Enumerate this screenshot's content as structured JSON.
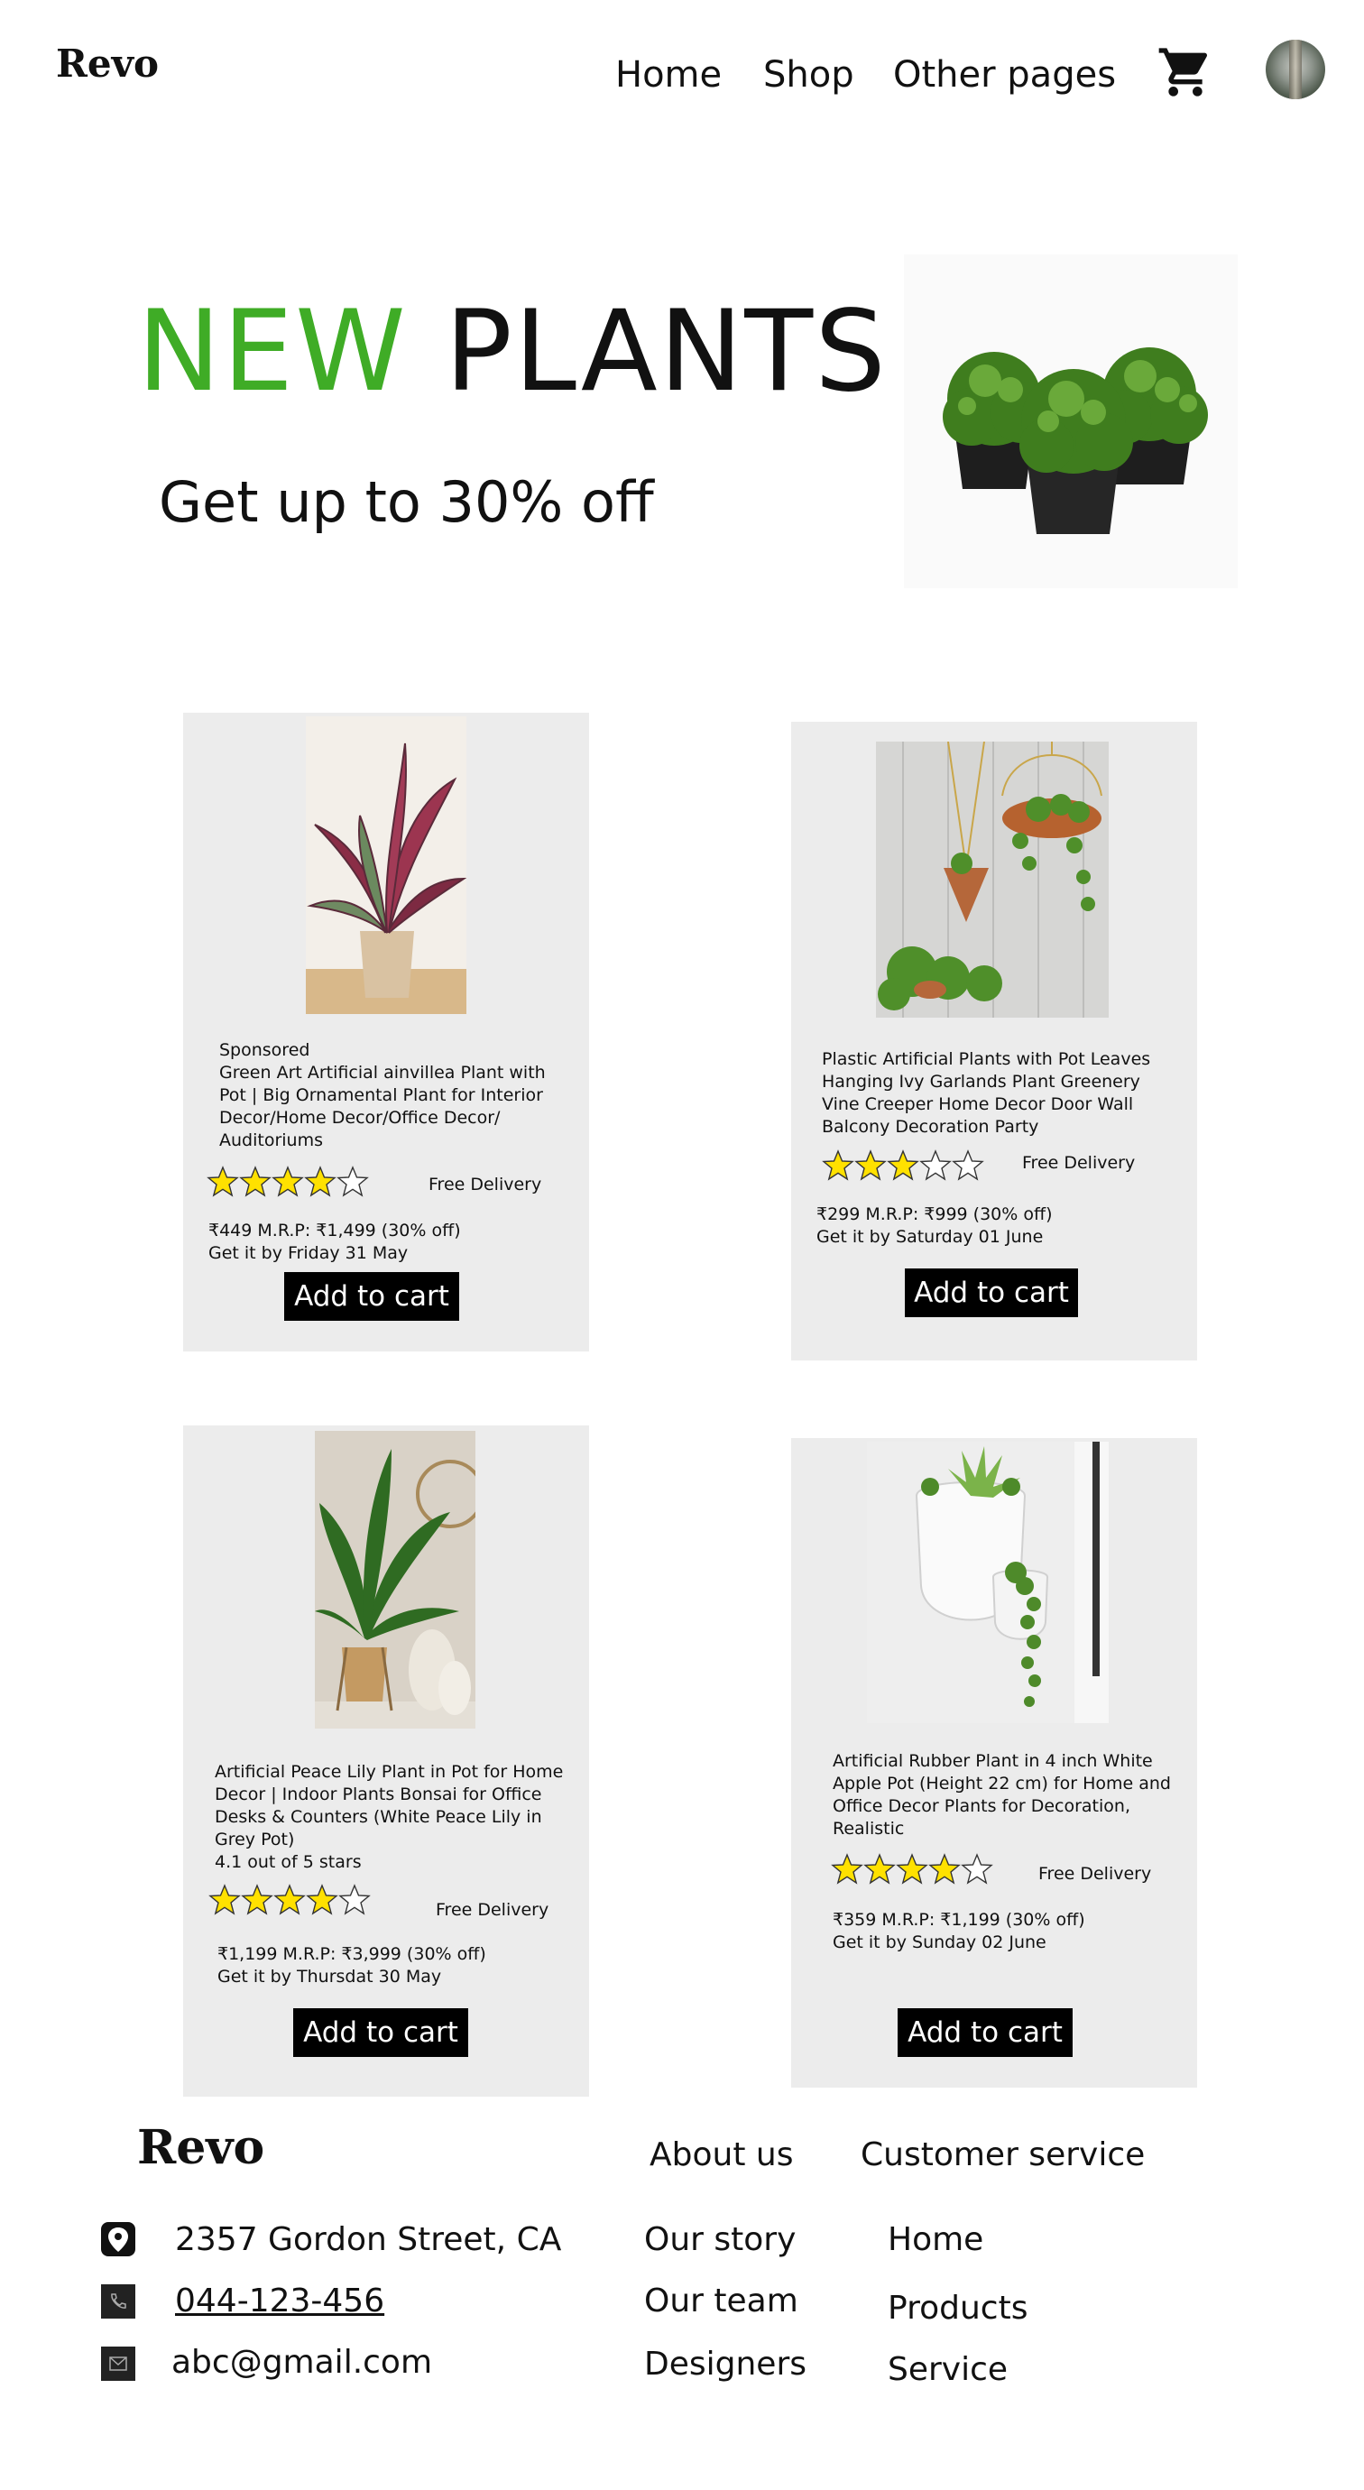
{
  "brand": "Revo",
  "nav": {
    "home": "Home",
    "shop": "Shop",
    "other": "Other pages"
  },
  "hero": {
    "title_green": "NEW",
    "title_rest": "PLANTS",
    "subtitle": "Get up to 30% off"
  },
  "colors": {
    "accent": "#3fac26",
    "card_bg": "#ececec",
    "button_bg": "#000000",
    "star": "#ffe100"
  },
  "products": [
    {
      "sponsored": "Sponsored",
      "title": "Green Art Artificial ainvillea Plant with Pot | Big Ornamental Plant for Interior Decor/Home Decor/Office Decor/ Auditoriums",
      "rating_text": "",
      "rating": 4,
      "delivery": "Free Delivery",
      "price": "₹449 M.R.P: ₹1,499 (30% off)",
      "eta": "Get it by Friday 31 May",
      "button": "Add to cart"
    },
    {
      "sponsored": "",
      "title": "Plastic Artificial Plants with Pot Leaves Hanging Ivy Garlands Plant Greenery Vine Creeper Home Decor Door Wall Balcony Decoration Party",
      "rating_text": "",
      "rating": 3,
      "delivery": "Free Delivery",
      "price": "₹299 M.R.P: ₹999 (30% off)",
      "eta": "Get it by Saturday 01 June",
      "button": "Add to cart"
    },
    {
      "sponsored": "",
      "title": "Artificial Peace Lily Plant in Pot for Home Decor | Indoor Plants Bonsai for Office Desks & Counters (White Peace Lily in Grey Pot)",
      "rating_text": "4.1 out of 5 stars",
      "rating": 4,
      "delivery": "Free Delivery",
      "price": "₹1,199 M.R.P: ₹3,999 (30% off)",
      "eta": "Get it by Thursdat 30 May",
      "button": "Add to cart"
    },
    {
      "sponsored": "",
      "title": "Artificial Rubber Plant in 4 inch White Apple Pot (Height 22 cm) for Home and Office Decor Plants for Decoration, Realistic",
      "rating_text": "",
      "rating": 4,
      "delivery": "Free Delivery",
      "price": "₹359 M.R.P: ₹1,199 (30% off)",
      "eta": "Get it by Sunday 02 June",
      "button": "Add to cart"
    }
  ],
  "footer": {
    "brand": "Revo",
    "contact": {
      "address": "2357 Gordon Street, CA",
      "phone": "044-123-456",
      "email": "abc@gmail.com"
    },
    "about": {
      "heading": "About us",
      "links": [
        "Our story",
        "Our team",
        "Designers"
      ]
    },
    "service": {
      "heading": "Customer service",
      "links": [
        "Home",
        "Products",
        "Service"
      ]
    }
  },
  "icons": {
    "cart": "cart-icon",
    "location": "location-pin-icon",
    "phone": "phone-icon",
    "email": "mail-icon"
  }
}
